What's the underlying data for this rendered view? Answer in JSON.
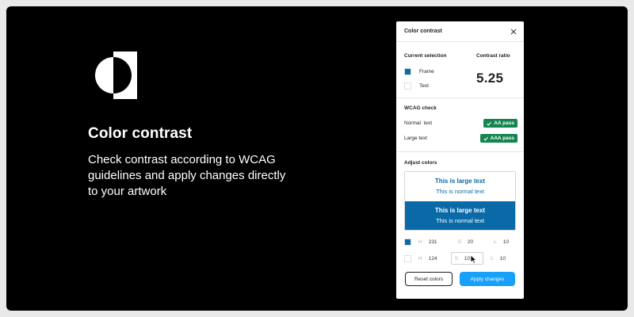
{
  "hero": {
    "title": "Color contrast",
    "description": "Check contrast according to WCAG guidelines and apply changes directly to your artwork",
    "logo_icon": "half-circle-square-logo"
  },
  "panel": {
    "title": "Color contrast",
    "close_icon": "close-icon"
  },
  "selection": {
    "label": "Current selection",
    "items": [
      {
        "label": "Frame",
        "color": "#0a6aa7"
      },
      {
        "label": "Text",
        "color": "#ffffff"
      }
    ],
    "ratio_label": "Contrast ratio",
    "ratio_value": "5.25"
  },
  "wcag": {
    "label": "WCAG check",
    "rows": [
      {
        "label": "Normal  text",
        "badge": "AA pass"
      },
      {
        "label": "Large text",
        "badge": "AAA pass"
      }
    ],
    "badge_color": "#13854f"
  },
  "adjust": {
    "label": "Adjust colors",
    "preview": {
      "light": {
        "large": "This is large text",
        "normal": "This is normal text"
      },
      "dark": {
        "large": "This is large text",
        "normal": "This is normal text"
      }
    },
    "rows": [
      {
        "color": "#0a6aa7",
        "h_letter": "H",
        "h": "231",
        "s_letter": "S",
        "s": "20",
        "l_letter": "L",
        "l": "10"
      },
      {
        "color": "#ffffff",
        "h_letter": "H",
        "h": "124",
        "s_letter": "S",
        "s": "10",
        "l_letter": "L",
        "l": "10"
      }
    ],
    "reset_label": "Reset colors",
    "apply_label": "Apply changes",
    "accent_color": "#18a0fb"
  }
}
